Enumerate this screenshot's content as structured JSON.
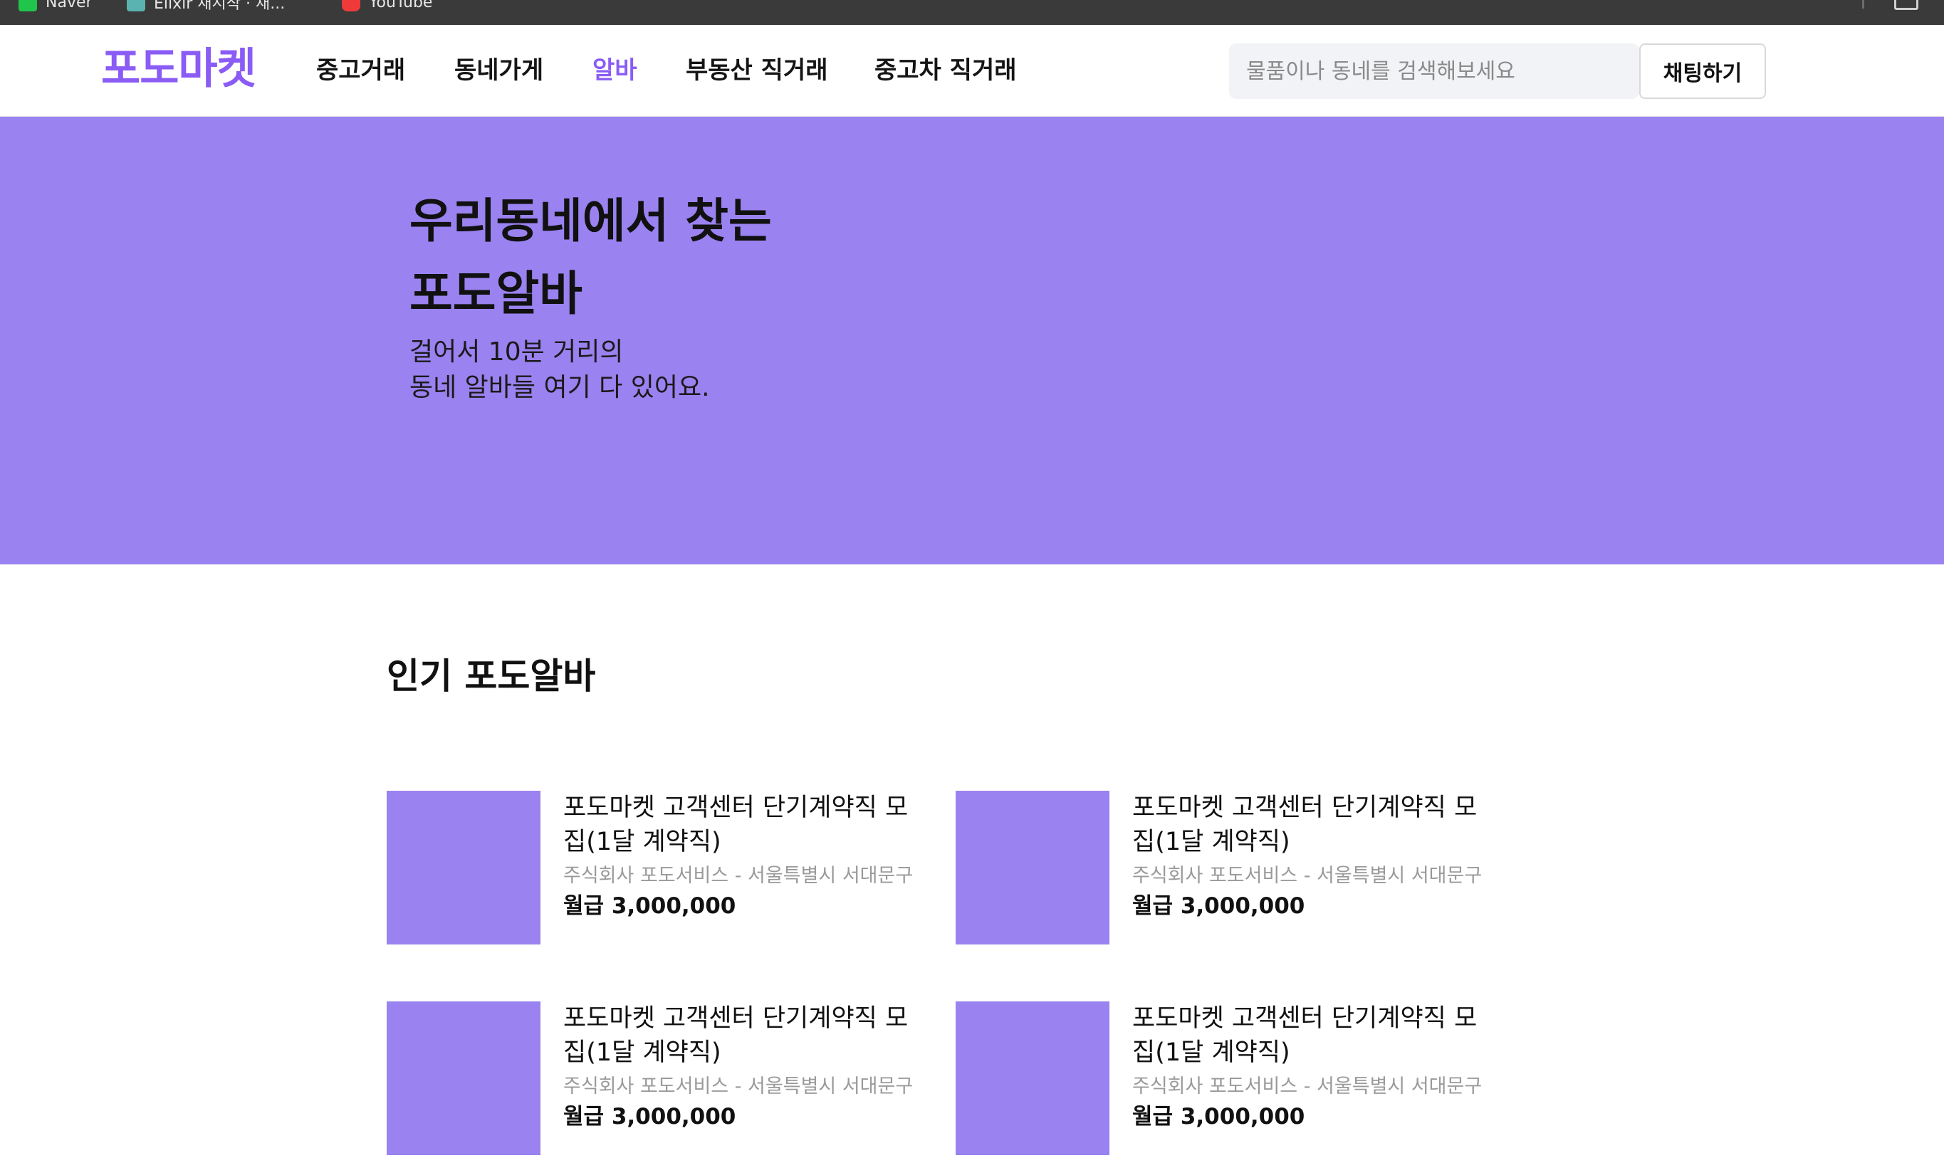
{
  "browser": {
    "bookmarks": [
      {
        "label": "Naver",
        "icon": "naver-favicon"
      },
      {
        "label": "Elixir 재시작 · 재...",
        "icon": "bookmark-favicon"
      },
      {
        "label": "YouTube",
        "icon": "youtube-favicon"
      }
    ]
  },
  "header": {
    "logo": "포도마켓",
    "nav": [
      {
        "label": "중고거래",
        "active": false
      },
      {
        "label": "동네가게",
        "active": false
      },
      {
        "label": "알바",
        "active": true
      },
      {
        "label": "부동산 직거래",
        "active": false
      },
      {
        "label": "중고차 직거래",
        "active": false
      }
    ],
    "search_placeholder": "물품이나 동네를 검색해보세요",
    "chat_label": "채팅하기"
  },
  "hero": {
    "title_lines": [
      "우리동네에서 찾는",
      "포도알바"
    ],
    "subtitle_lines": [
      "걸어서 10분 거리의",
      "동네 알바들 여기 다 있어요."
    ]
  },
  "popular": {
    "title": "인기 포도알바",
    "jobs": [
      {
        "title": "포도마켓 고객센터 단기계약직 모집(1달 계약직)",
        "company": "주식회사 포도서비스 - 서울특별시 서대문구",
        "salary": "월급 3,000,000"
      },
      {
        "title": "포도마켓 고객센터 단기계약직 모집(1달 계약직)",
        "company": "주식회사 포도서비스 - 서울특별시 서대문구",
        "salary": "월급 3,000,000"
      },
      {
        "title": "포도마켓 고객센터 단기계약직 모집(1달 계약직)",
        "company": "주식회사 포도서비스 - 서울특별시 서대문구",
        "salary": "월급 3,000,000"
      },
      {
        "title": "포도마켓 고객센터 단기계약직 모집(1달 계약직)",
        "company": "주식회사 포도서비스 - 서울특별시 서대문구",
        "salary": "월급 3,000,000"
      }
    ]
  },
  "colors": {
    "brand": "#8a5cf5",
    "hero_bg": "#9a82f0",
    "thumbnail": "#9a82f0",
    "search_bg": "#f2f3f6"
  }
}
